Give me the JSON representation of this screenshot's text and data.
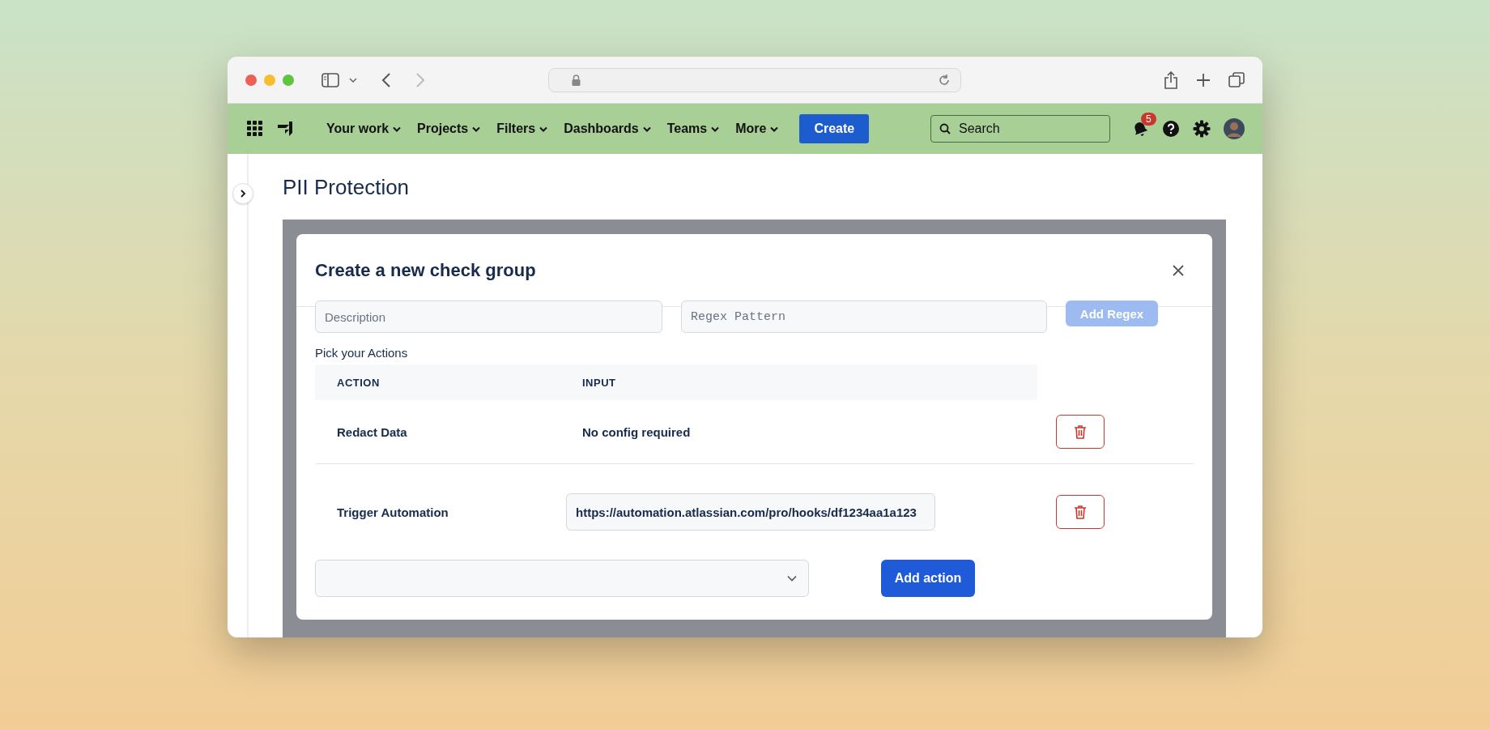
{
  "nav": {
    "items": [
      {
        "label": "Your work"
      },
      {
        "label": "Projects"
      },
      {
        "label": "Filters"
      },
      {
        "label": "Dashboards"
      },
      {
        "label": "Teams"
      },
      {
        "label": "More"
      }
    ],
    "create_button": "Create",
    "search": {
      "placeholder": "Search"
    },
    "notifications_badge": "5"
  },
  "page": {
    "title": "PII Protection"
  },
  "modal": {
    "title": "Create a new check group",
    "fields": [
      {
        "placeholder": "Description",
        "kind": "text"
      },
      {
        "placeholder": "Regex Pattern",
        "kind": "mono"
      }
    ],
    "add_regex_button": {
      "label": "Add Regex",
      "disabled": true
    },
    "section_label": "Pick your Actions",
    "table": {
      "columns": [
        "ACTION",
        "INPUT"
      ],
      "rows": [
        {
          "action": "Redact Data",
          "kind": "text",
          "input": "No config required"
        },
        {
          "action": "Trigger Automation",
          "kind": "input",
          "input": "https://automation.atlassian.com/pro/hooks/df1234aa1a123"
        }
      ]
    },
    "add_action_button": "Add action"
  }
}
